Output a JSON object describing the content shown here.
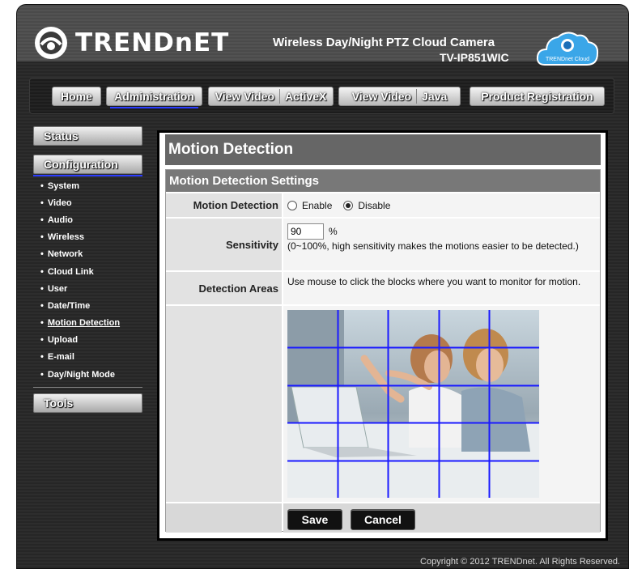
{
  "header": {
    "logo_text": "TRENDnET",
    "product_title": "Wireless Day/Night PTZ Cloud Camera",
    "product_model": "TV-IP851WIC",
    "cloud_badge": "TRENDnet Cloud"
  },
  "nav": {
    "home": "Home",
    "administration": "Administration",
    "view_video_activex_a": "View Video",
    "view_video_activex_b": "ActiveX",
    "view_video_java_a": "View Video",
    "view_video_java_b": "Java",
    "product_registration": "Product Registration"
  },
  "sidebar": {
    "status": "Status",
    "configuration": "Configuration",
    "items": [
      {
        "label": "System"
      },
      {
        "label": "Video"
      },
      {
        "label": "Audio"
      },
      {
        "label": "Wireless"
      },
      {
        "label": "Network"
      },
      {
        "label": "Cloud Link"
      },
      {
        "label": "User"
      },
      {
        "label": "Date/Time"
      },
      {
        "label": "Motion Detection"
      },
      {
        "label": "Upload"
      },
      {
        "label": "E-mail"
      },
      {
        "label": "Day/Night Mode"
      }
    ],
    "bullet": "•",
    "tools": "Tools"
  },
  "content": {
    "title": "Motion Detection",
    "settings_heading": "Motion Detection Settings",
    "motion_detection_label": "Motion Detection",
    "enable_label": "Enable",
    "disable_label": "Disable",
    "selected": "Disable",
    "sensitivity_label": "Sensitivity",
    "sensitivity_value": "90",
    "sensitivity_unit": "%",
    "sensitivity_help": "(0~100%, high sensitivity makes the motions easier to be detected.)",
    "detection_areas_label": "Detection Areas",
    "detection_areas_help": "Use mouse to click the blocks where you want to monitor for motion.",
    "grid_columns": 5,
    "grid_rows": 5,
    "save_label": "Save",
    "cancel_label": "Cancel"
  },
  "footer": {
    "copyright": "Copyright © 2012 TRENDnet.  All Rights Reserved."
  },
  "colors": {
    "grid_line": "#1a1aff",
    "accent_underline": "#2b3cff"
  }
}
